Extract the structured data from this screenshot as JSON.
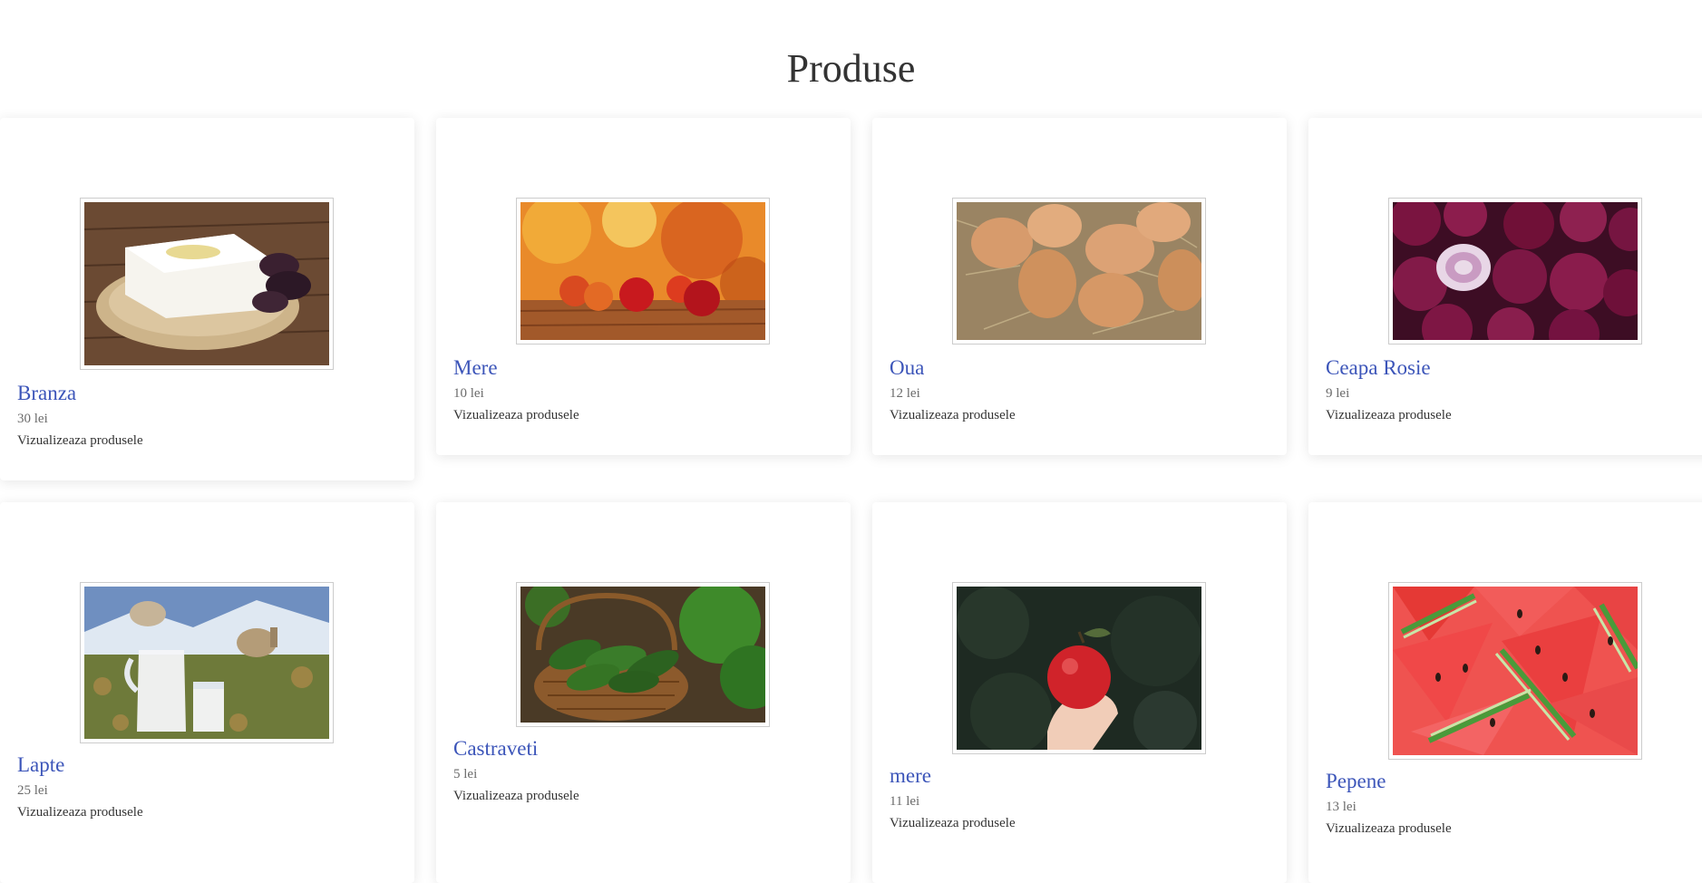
{
  "page": {
    "title": "Produse"
  },
  "products": [
    {
      "name": "Branza",
      "price": "30 lei",
      "link": "Vizualizeaza produsele",
      "image": "feta-cheese-on-plate"
    },
    {
      "name": "Mere",
      "price": "10 lei",
      "link": "Vizualizeaza produsele",
      "image": "apples-on-table"
    },
    {
      "name": "Oua",
      "price": "12 lei",
      "link": "Vizualizeaza produsele",
      "image": "eggs-in-straw"
    },
    {
      "name": "Ceapa Rosie",
      "price": "9 lei",
      "link": "Vizualizeaza produsele",
      "image": "red-onions"
    },
    {
      "name": "Lapte",
      "price": "25 lei",
      "link": "Vizualizeaza produsele",
      "image": "milk-jug-and-goats"
    },
    {
      "name": "Castraveti",
      "price": "5 lei",
      "link": "Vizualizeaza produsele",
      "image": "cucumbers-in-basket"
    },
    {
      "name": "mere",
      "price": "11 lei",
      "link": "Vizualizeaza produsele",
      "image": "hand-holding-apple"
    },
    {
      "name": "Pepene",
      "price": "13 lei",
      "link": "Vizualizeaza produsele",
      "image": "watermelon-slices"
    }
  ]
}
